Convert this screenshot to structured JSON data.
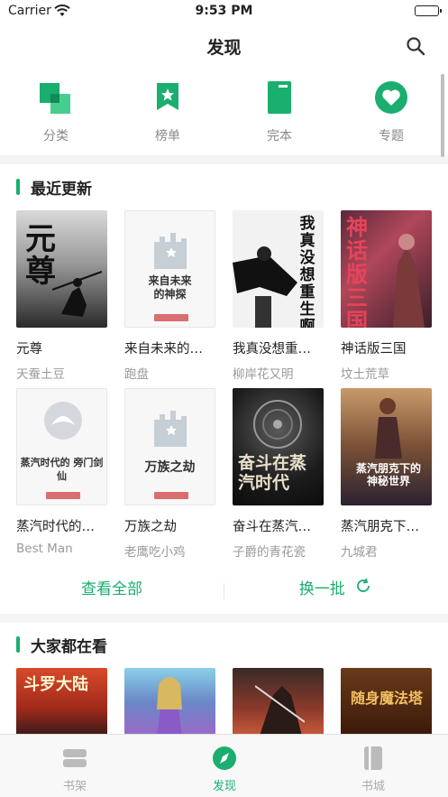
{
  "status": {
    "carrier": "Carrier",
    "time": "9:53 PM"
  },
  "navbar": {
    "title": "发现"
  },
  "quick": [
    {
      "label": "分类",
      "icon": "category-icon"
    },
    {
      "label": "榜单",
      "icon": "ranking-icon"
    },
    {
      "label": "完本",
      "icon": "finished-book-icon"
    },
    {
      "label": "专题",
      "icon": "topic-heart-icon"
    }
  ],
  "recent": {
    "title": "最近更新",
    "books": [
      {
        "name": "元尊",
        "author": "天蚕土豆",
        "cover_text": "元尊"
      },
      {
        "name": "来自未来的…",
        "author": "跑盘",
        "cover_text": "来自未来\n的神探"
      },
      {
        "name": "我真没想重…",
        "author": "柳岸花又明",
        "cover_text": "我真没想重生啊"
      },
      {
        "name": "神话版三国",
        "author": "坟土荒草",
        "cover_text": "神话版三国"
      },
      {
        "name": "蒸汽时代的…",
        "author": "Best Man",
        "cover_text": "蒸汽时代的\n旁门剑仙"
      },
      {
        "name": "万族之劫",
        "author": "老鹰吃小鸡",
        "cover_text": "万族之劫"
      },
      {
        "name": "奋斗在蒸汽…",
        "author": "子爵的青花瓷",
        "cover_text": "奋斗在蒸汽时代"
      },
      {
        "name": "蒸汽朋克下…",
        "author": "九城君",
        "cover_text": "蒸汽朋克下的神秘世界"
      }
    ]
  },
  "actions": {
    "view_all": "查看全部",
    "refresh": "换一批"
  },
  "popular": {
    "title": "大家都在看",
    "books": [
      {
        "cover_text": "斗罗大陆"
      },
      {
        "cover_text": ""
      },
      {
        "cover_text": ""
      },
      {
        "cover_text": "随身魔法塔"
      }
    ]
  },
  "tabs": [
    {
      "label": "书架",
      "active": false
    },
    {
      "label": "发现",
      "active": true
    },
    {
      "label": "书城",
      "active": false
    }
  ],
  "colors": {
    "accent": "#1aae6f"
  }
}
